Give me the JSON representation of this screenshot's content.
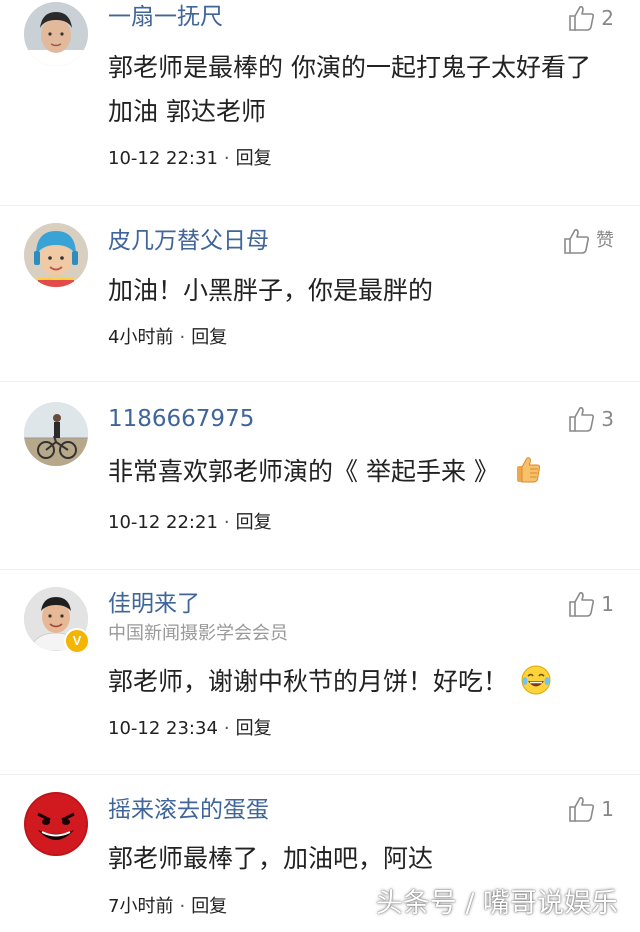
{
  "comments": [
    {
      "user": "一扇一抚尺",
      "title": "",
      "text": "郭老师是最棒的 你演的一起打鬼子太好看了 加油 郭达老师",
      "time": "10-12 22:31",
      "reply_label": "回复",
      "like_count": "2",
      "avatar_icon": "young-man-portrait"
    },
    {
      "user": "皮几万替父日母",
      "title": "",
      "text": "加油！小黑胖子，你是最胖的",
      "time": "4小时前",
      "reply_label": "回复",
      "like_count": "赞",
      "avatar_icon": "child-helmet-portrait"
    },
    {
      "user": "1186667975",
      "title": "",
      "text": "非常喜欢郭老师演的《 举起手来 》",
      "text_emoji": "thumbs-up-emoji",
      "time": "10-12 22:21",
      "reply_label": "回复",
      "like_count": "3",
      "avatar_icon": "cyclist-landscape"
    },
    {
      "user": "佳明来了",
      "title": "中国新闻摄影学会会员",
      "text": "郭老师，谢谢中秋节的月饼！好吃！",
      "text_emoji": "laughing-tears-emoji",
      "time": "10-12 23:34",
      "reply_label": "回复",
      "like_count": "1",
      "avatar_icon": "man-portrait",
      "verified_badge": "V"
    },
    {
      "user": "摇来滚去的蛋蛋",
      "title": "",
      "text": "郭老师最棒了，加油吧，阿达",
      "time": "7小时前",
      "reply_label": "回复",
      "like_count": "1",
      "avatar_icon": "red-devil-smiley"
    }
  ],
  "watermark": "头条号 / 嘴哥说娱乐",
  "colors": {
    "username": "#406599",
    "text": "#222222",
    "muted": "#999999",
    "badge": "#f4b400"
  }
}
